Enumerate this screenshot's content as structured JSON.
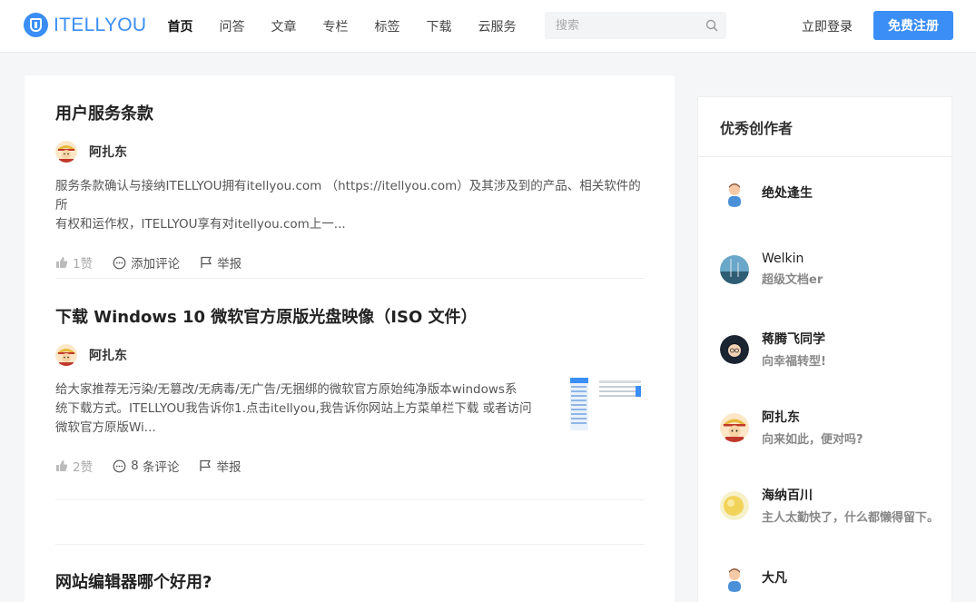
{
  "header": {
    "logo_text": "ITELLYOU",
    "nav": [
      "首页",
      "问答",
      "文章",
      "专栏",
      "标签",
      "下载",
      "云服务"
    ],
    "search_placeholder": "搜索",
    "login_label": "立即登录",
    "register_label": "免费注册",
    "accent_color": "#3a8ef6"
  },
  "articles": [
    {
      "title": "用户服务条款",
      "author": "阿扎东",
      "excerpt_line1": "服务条款确认与接纳ITELLYOU拥有itellyou.com （https://itellyou.com）及其涉及到的产品、相关软件的所",
      "excerpt_line2": "有权和运作权，ITELLYOU享有对itellyou.com上一...",
      "likes": "1赞",
      "comment_label": "添加评论",
      "report_label": "举报"
    },
    {
      "title": "下载 Windows 10 微软官方原版光盘映像（ISO 文件）",
      "author": "阿扎东",
      "excerpt_line1": "给大家推荐无污染/无篡改/无病毒/无广告/无捆绑的微软官方原始纯净版本windows系",
      "excerpt_line2": "统下载方式。ITELLYOU我告诉你1.点击itellyou,我告诉你网站上方菜单栏下载 或者访问",
      "excerpt_line3": "微软官方原版Wi...",
      "likes": "2赞",
      "comment_count": "8",
      "comment_label": "条评论",
      "report_label": "举报"
    },
    {
      "title": "网站编辑器哪个好用?"
    }
  ],
  "sidebar": {
    "title": "优秀创作者",
    "creators": [
      {
        "name": "绝处逢生",
        "bio": ""
      },
      {
        "name": "Welkin",
        "bio": "超级文档er"
      },
      {
        "name": "蒋腾飞同学",
        "bio": "向幸福转型!"
      },
      {
        "name": "阿扎东",
        "bio": "向来如此，便对吗?"
      },
      {
        "name": "海纳百川",
        "bio": "主人太勤快了，什么都懒得留下。"
      },
      {
        "name": "大凡",
        "bio": ""
      }
    ]
  }
}
